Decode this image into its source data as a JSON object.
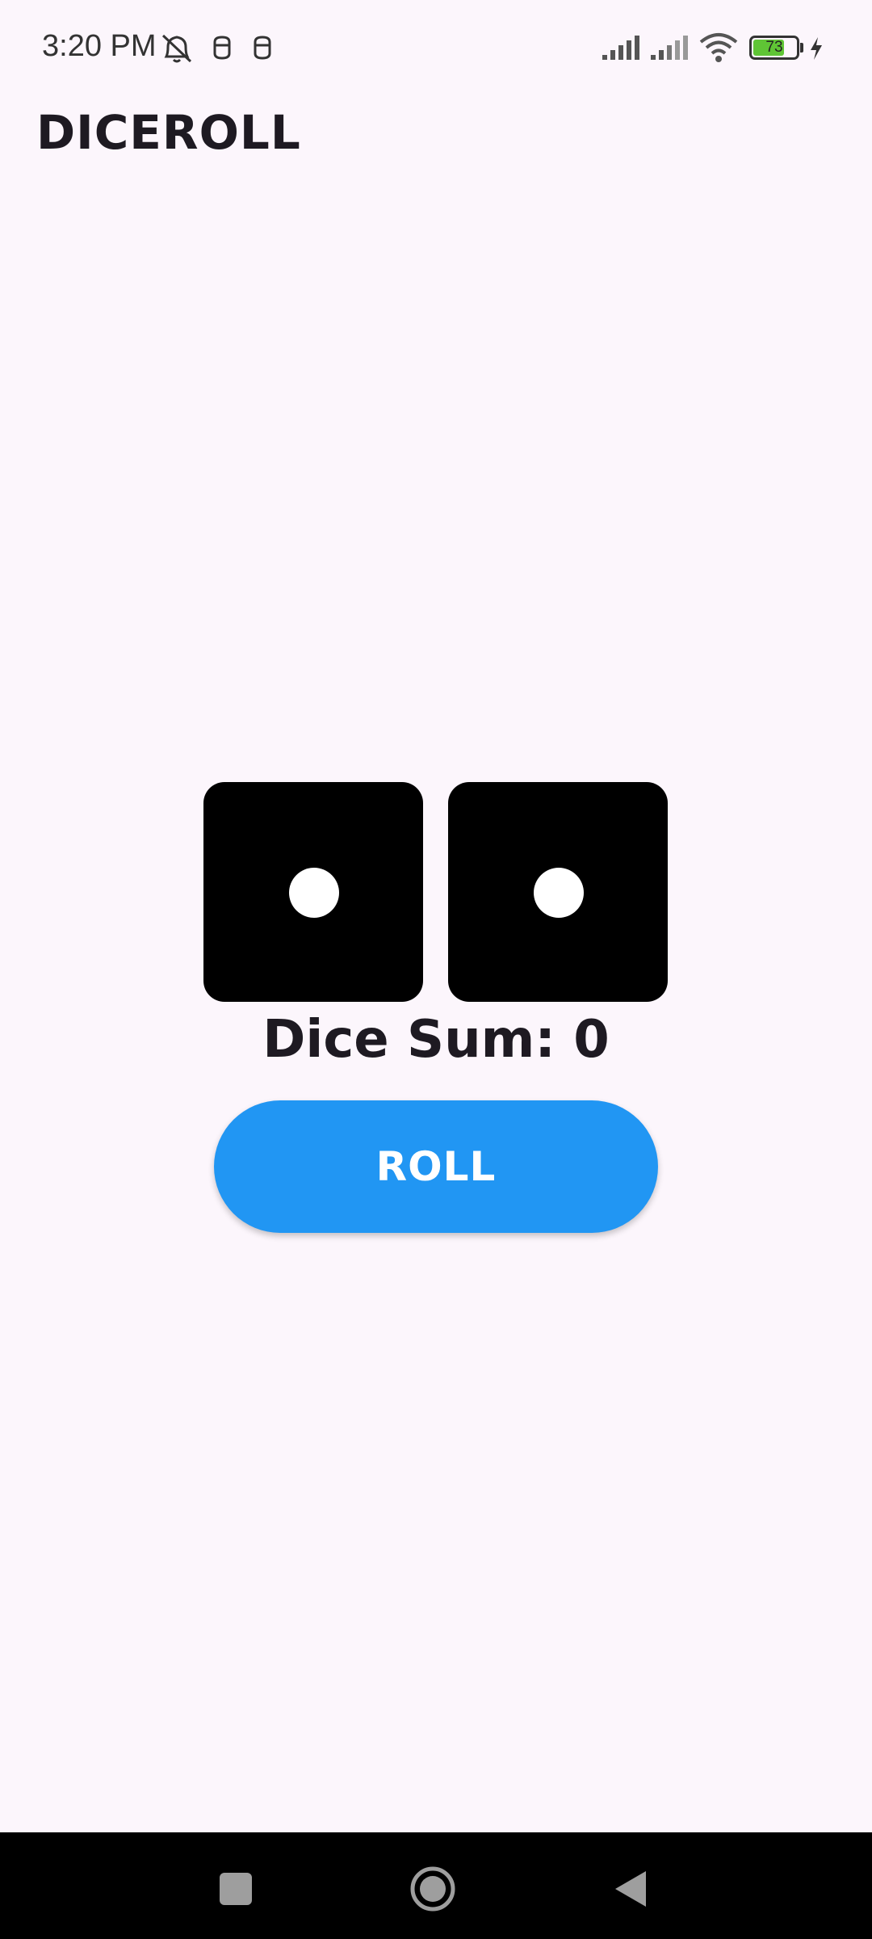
{
  "status_bar": {
    "time": "3:20 PM",
    "battery_level": "73",
    "icons": [
      "alarm-off-icon",
      "notification-icon",
      "notification-icon",
      "signal-icon",
      "signal-icon",
      "wifi-icon",
      "battery-icon",
      "charging-icon"
    ]
  },
  "app": {
    "title": "DICEROLL"
  },
  "dice": [
    {
      "value": 1
    },
    {
      "value": 1
    }
  ],
  "sum_label": "Dice Sum: 0",
  "roll_button_label": "ROLL",
  "colors": {
    "background": "#FCF6FC",
    "die": "#000000",
    "pip": "#FFFFFF",
    "button": "#2196F3",
    "text": "#1E1A22"
  },
  "nav_bar": {
    "buttons": [
      "recent-apps-icon",
      "home-icon",
      "back-icon"
    ]
  }
}
